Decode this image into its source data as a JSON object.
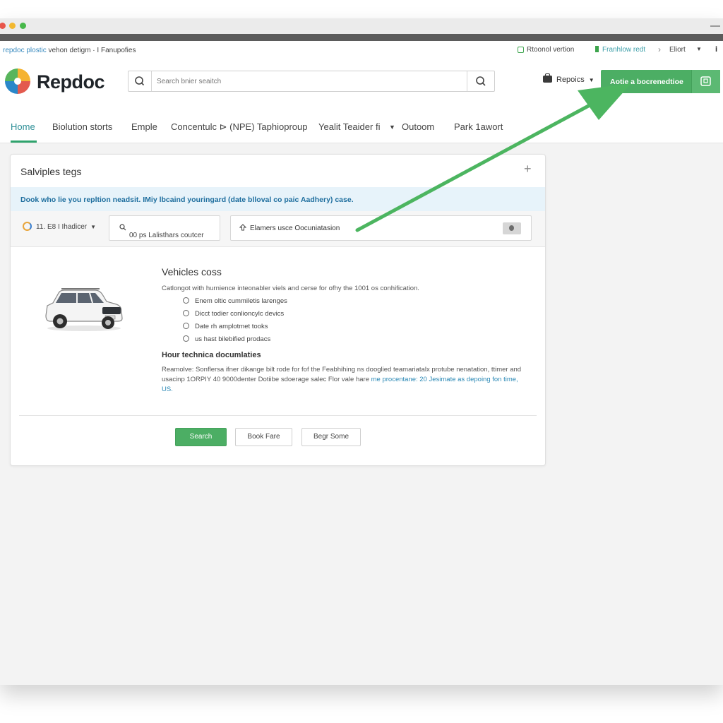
{
  "infobar": {
    "site_brand": "repdoc plostic",
    "site_path": "vehon detigm · I Fanupofies",
    "version_label": "Rtoonol vertion",
    "feature_label": "Franhlow redt",
    "user_label": "Eliort"
  },
  "header": {
    "logo_text": "Repdoc",
    "search_placeholder": "Search bnier seaitch",
    "repos_label": "Repoics",
    "cta_label": "Aotie a bocrenedtioe"
  },
  "nav": {
    "items": [
      {
        "label": "Home",
        "active": true
      },
      {
        "label": "Biolution storts"
      },
      {
        "label": "Emple"
      },
      {
        "label": "Concentulc ⊳ (NPE) Taphioproup"
      },
      {
        "label": "Yealit Teaider fi"
      },
      {
        "label": "Outoom"
      },
      {
        "label": "Park 1awort"
      }
    ]
  },
  "card": {
    "title": "Salviples tegs",
    "banner": "Dook who lie you repltion neadsit. IMiy lbcaind youringard (date blloval co paic Aadhery) case.",
    "filter1": "11. E8 I Ihadicer",
    "filter2": "00 ps Lalisthars coutcer",
    "filter3": "Elamers usce Oocuniatasion",
    "heading": "Vehicles coss",
    "description": "Catlongot with hurnience inteonabler viels and cerse for ofhy the 1001 os conhification.",
    "options": [
      "Enem oltic cummiletis larenges",
      "Dicct todier conlioncylc devics",
      "Date rh amplotmet tooks",
      "us hast bilebified prodacs"
    ],
    "subheading": "Hour technica documlaties",
    "paragraph": "Reamolve: Sonflersa ifner dikange bilt rode for fof the Feabhihing ns dooglied teamariatalx protube nenatation, ttimer and usacinp 1ORPIY 40 9000denter Dotiibe sdoerage salec Flor vale hare",
    "paragraph_link": "me procentane: 20 Jesimate as depoing fon time, US.",
    "buttons": {
      "primary": "Search",
      "second": "Book Fare",
      "third": "Begr Some"
    }
  },
  "colors": {
    "accent_green": "#4cae64",
    "link_blue": "#2a88b5",
    "banner_bg": "#e7f3fa"
  },
  "icons": [
    "search-icon",
    "magnify-icon",
    "briefcase-icon",
    "chevron-down-icon",
    "plus-icon",
    "grid-icon",
    "info-icon",
    "upload-icon"
  ]
}
